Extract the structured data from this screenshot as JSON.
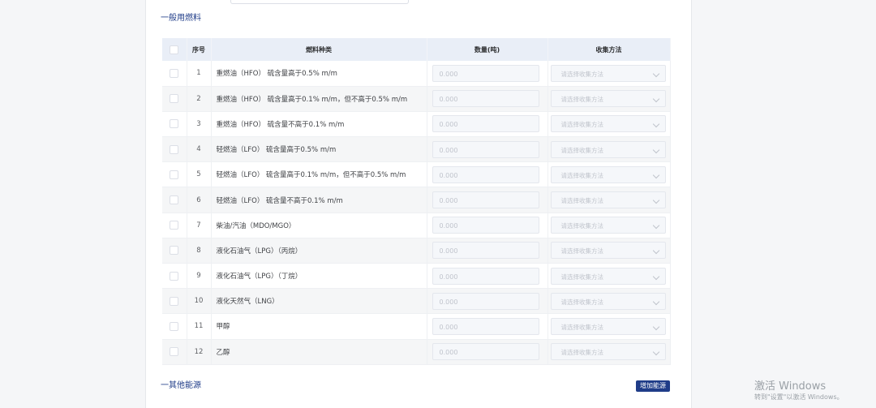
{
  "sections": {
    "fuel_title": "一般用燃料",
    "other_title": "一其他能源",
    "add_energy_button": "增加能源"
  },
  "table": {
    "headers": {
      "no": "序号",
      "type": "燃料种类",
      "quantity": "数量(吨)",
      "method": "收集方法"
    },
    "rows": [
      {
        "no": "1",
        "type": "重燃油（HFO） 硫含量高于0.5% m/m",
        "quantity": "0.000",
        "method": "请选择收集方法"
      },
      {
        "no": "2",
        "type": "重燃油（HFO） 硫含量高于0.1% m/m，但不高于0.5% m/m",
        "quantity": "0.000",
        "method": "请选择收集方法"
      },
      {
        "no": "3",
        "type": "重燃油（HFO） 硫含量不高于0.1% m/m",
        "quantity": "0.000",
        "method": "请选择收集方法"
      },
      {
        "no": "4",
        "type": "轻燃油（LFO） 硫含量高于0.5% m/m",
        "quantity": "0.000",
        "method": "请选择收集方法"
      },
      {
        "no": "5",
        "type": "轻燃油（LFO） 硫含量高于0.1% m/m，但不高于0.5% m/m",
        "quantity": "0.000",
        "method": "请选择收集方法"
      },
      {
        "no": "6",
        "type": "轻燃油（LFO） 硫含量不高于0.1% m/m",
        "quantity": "0.000",
        "method": "请选择收集方法"
      },
      {
        "no": "7",
        "type": "柴油/汽油（MDO/MGO）",
        "quantity": "0.000",
        "method": "请选择收集方法"
      },
      {
        "no": "8",
        "type": "液化石油气（LPG）（丙烷）",
        "quantity": "0.000",
        "method": "请选择收集方法"
      },
      {
        "no": "9",
        "type": "液化石油气（LPG）（丁烷）",
        "quantity": "0.000",
        "method": "请选择收集方法"
      },
      {
        "no": "10",
        "type": "液化天然气（LNG）",
        "quantity": "0.000",
        "method": "请选择收集方法"
      },
      {
        "no": "11",
        "type": "甲醇",
        "quantity": "0.000",
        "method": "请选择收集方法"
      },
      {
        "no": "12",
        "type": "乙醇",
        "quantity": "0.000",
        "method": "请选择收集方法"
      }
    ]
  },
  "watermark": {
    "line1": "激活 Windows",
    "line2": "转到\"设置\"以激活 Windows。"
  },
  "colors": {
    "accent": "#1f3c88",
    "header_bg": "#e9eef7",
    "stripe_bg": "#f5f6f7"
  }
}
